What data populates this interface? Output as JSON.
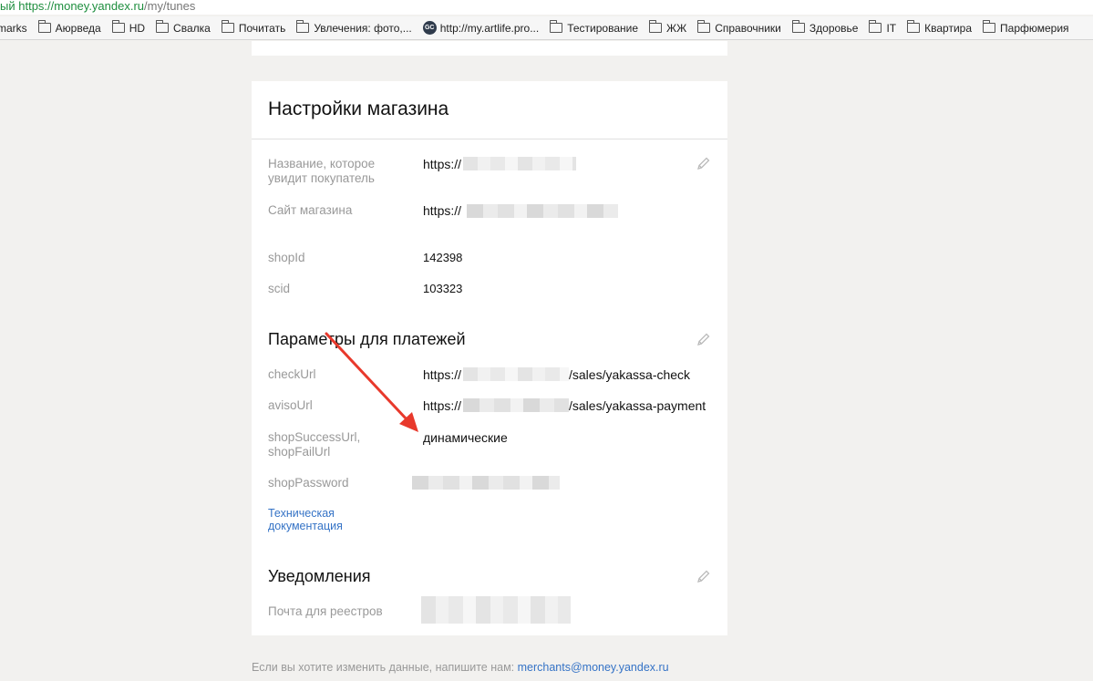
{
  "browser": {
    "url_prefix": "ый",
    "url_scheme": "https://",
    "url_host": "money.yandex.ru",
    "url_path": "/my/tunes",
    "bookmarks": [
      "marks",
      "Аюрведа",
      "HD",
      "Свалка",
      "Почитать",
      "Увлечения: фото,...",
      "http://my.artlife.pro...",
      "Тестирование",
      "ЖЖ",
      "Справочники",
      "Здоровье",
      "IT",
      "Квартира",
      "Парфюмерия"
    ],
    "bookmark_badge": "GC"
  },
  "settings": {
    "title": "Настройки магазина",
    "name_label": "Название, которое увидит покупатель",
    "name_value": "https://",
    "site_label": "Сайт магазина",
    "site_value": "https://",
    "shopid_label": "shopId",
    "shopid_value": "142398",
    "scid_label": "scid",
    "scid_value": "103323"
  },
  "payments": {
    "title": "Параметры для платежей",
    "checkurl_label": "checkUrl",
    "checkurl_prefix": "https://",
    "checkurl_suffix": "/sales/yakassa-check",
    "avisourl_label": "avisoUrl",
    "avisourl_prefix": "https://",
    "avisourl_suffix": "/sales/yakassa-payment",
    "success_label": "shopSuccessUrl, shopFailUrl",
    "success_value": "динамические",
    "password_label": "shopPassword",
    "doc_link": "Техническая документация"
  },
  "notifications": {
    "title": "Уведомления",
    "email_label": "Почта для реестров"
  },
  "footer": {
    "text": "Если вы хотите изменить данные, напишите нам: ",
    "email": "merchants@money.yandex.ru"
  },
  "colors": {
    "accent_link": "#3573c6",
    "arrow": "#e8392c"
  }
}
